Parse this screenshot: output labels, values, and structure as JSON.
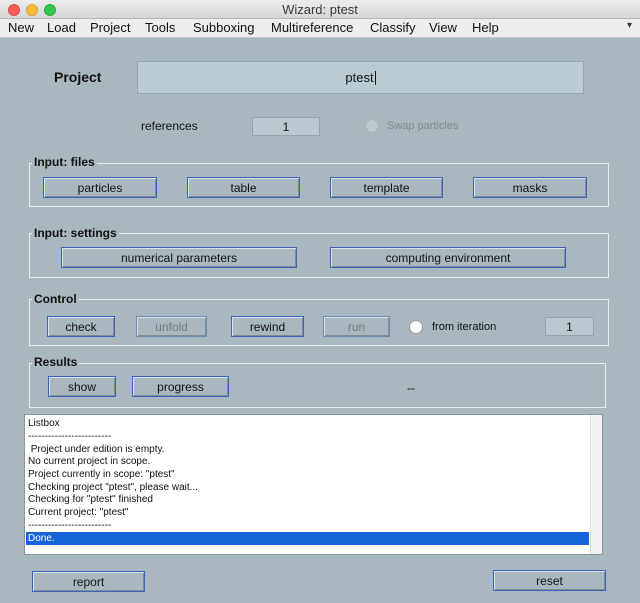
{
  "window": {
    "title": "Wizard: ptest"
  },
  "menu": [
    "New",
    "Load",
    "Project",
    "Tools",
    "Subboxing",
    "Multireference",
    "Classify",
    "View",
    "Help"
  ],
  "project": {
    "label": "Project",
    "value": "ptest"
  },
  "references": {
    "label": "references",
    "value": "1",
    "swap_label": "Swap particles"
  },
  "input_files": {
    "title": "Input: files",
    "buttons": [
      "particles",
      "table",
      "template",
      "masks"
    ]
  },
  "input_settings": {
    "title": "Input: settings",
    "buttons": [
      "numerical parameters",
      "computing environment"
    ]
  },
  "control": {
    "title": "Control",
    "buttons": [
      "check",
      "unfold",
      "rewind",
      "run"
    ],
    "from_iteration_label": "from iteration",
    "iteration_value": "1"
  },
  "results": {
    "title": "Results",
    "buttons": [
      "show",
      "progress"
    ],
    "status": "--"
  },
  "listbox": {
    "lines": [
      "Listbox",
      "-------------------------",
      " Project under edition is empty.",
      "No current project in scope.",
      "Project currently in scope: \"ptest\"",
      "Checking project \"ptest\", please wait...",
      "Checking for \"ptest\" finished",
      "Current project: \"ptest\"",
      "-------------------------",
      "Done."
    ]
  },
  "bottom": {
    "report": "report",
    "reset": "reset"
  }
}
